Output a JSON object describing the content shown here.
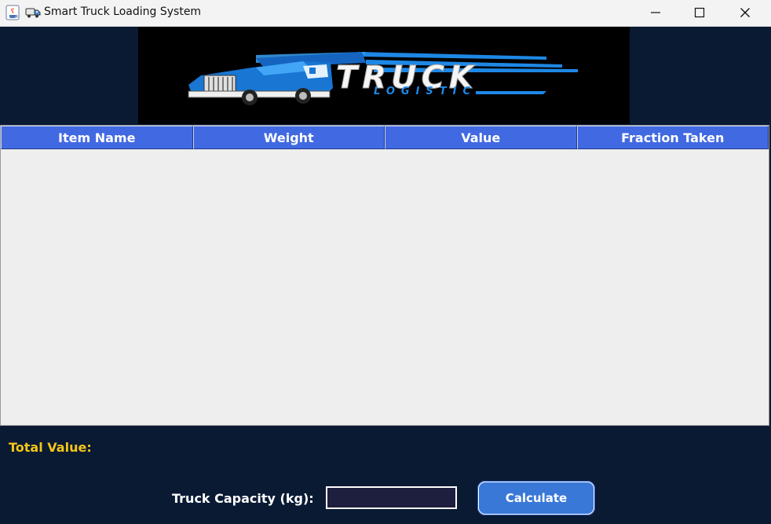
{
  "window": {
    "title": "Smart Truck Loading System",
    "minimize_icon": "minimize-icon",
    "maximize_icon": "maximize-icon",
    "close_icon": "close-icon"
  },
  "banner": {
    "logo_text": "TRUCK",
    "logo_subtext": "LOGISTIC",
    "colors": {
      "background": "#0a1a33",
      "logo_background": "#000000",
      "truck_blue": "#1e88e5"
    }
  },
  "table": {
    "columns": [
      "Item Name",
      "Weight",
      "Value",
      "Fraction Taken"
    ],
    "rows": [],
    "header_color": "#4169e1"
  },
  "summary": {
    "total_label": "Total Value:",
    "total_value": "",
    "label_color": "#f5c518"
  },
  "form": {
    "capacity_label": "Truck Capacity (kg):",
    "capacity_value": "",
    "calculate_label": "Calculate",
    "button_color": "#3a78d8"
  }
}
